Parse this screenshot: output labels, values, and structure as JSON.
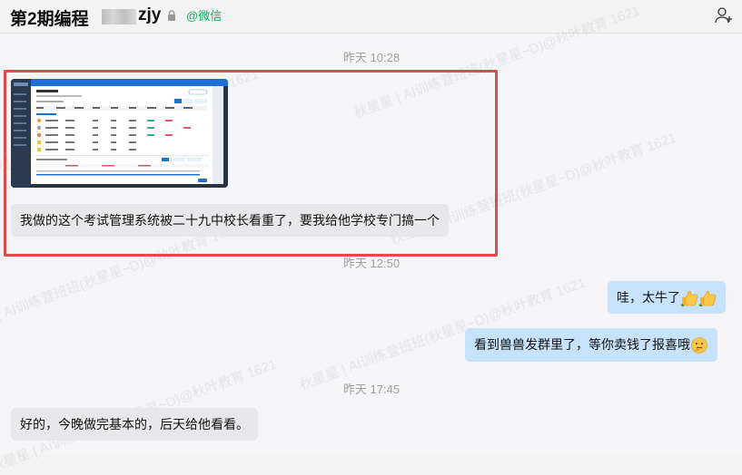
{
  "header": {
    "title_prefix": "第2期编程",
    "title_suffix": "zjy",
    "wechat_tag": "@微信"
  },
  "watermark": "秋星星 | AI训练营班班(秋星星~D)@秋叶教育 1621",
  "messages": [
    {
      "type": "time",
      "text": "昨天 10:28"
    },
    {
      "type": "image",
      "side": "left",
      "image": "exam-management-system-screenshot"
    },
    {
      "type": "text",
      "side": "left",
      "text": "我做的这个考试管理系统被二十九中校长看重了，要我给他学校专门搞一个"
    },
    {
      "type": "time",
      "text": "昨天 12:50"
    },
    {
      "type": "text",
      "side": "right",
      "text": "哇，太牛了",
      "emoji": "thumbs-up x2"
    },
    {
      "type": "text",
      "side": "right",
      "text": "看到兽兽发群里了，等你卖钱了报喜哦",
      "emoji": "thinking-face"
    },
    {
      "type": "time",
      "text": "昨天 17:45"
    },
    {
      "type": "text",
      "side": "left",
      "text": "好的，今晚做完基本的，后天给他看看。"
    }
  ],
  "colors": {
    "highlight": "#e24a4a",
    "right_bubble": "#c7e3fb",
    "left_bubble": "#e8e8eb",
    "wechat_green": "#1aad5c"
  }
}
